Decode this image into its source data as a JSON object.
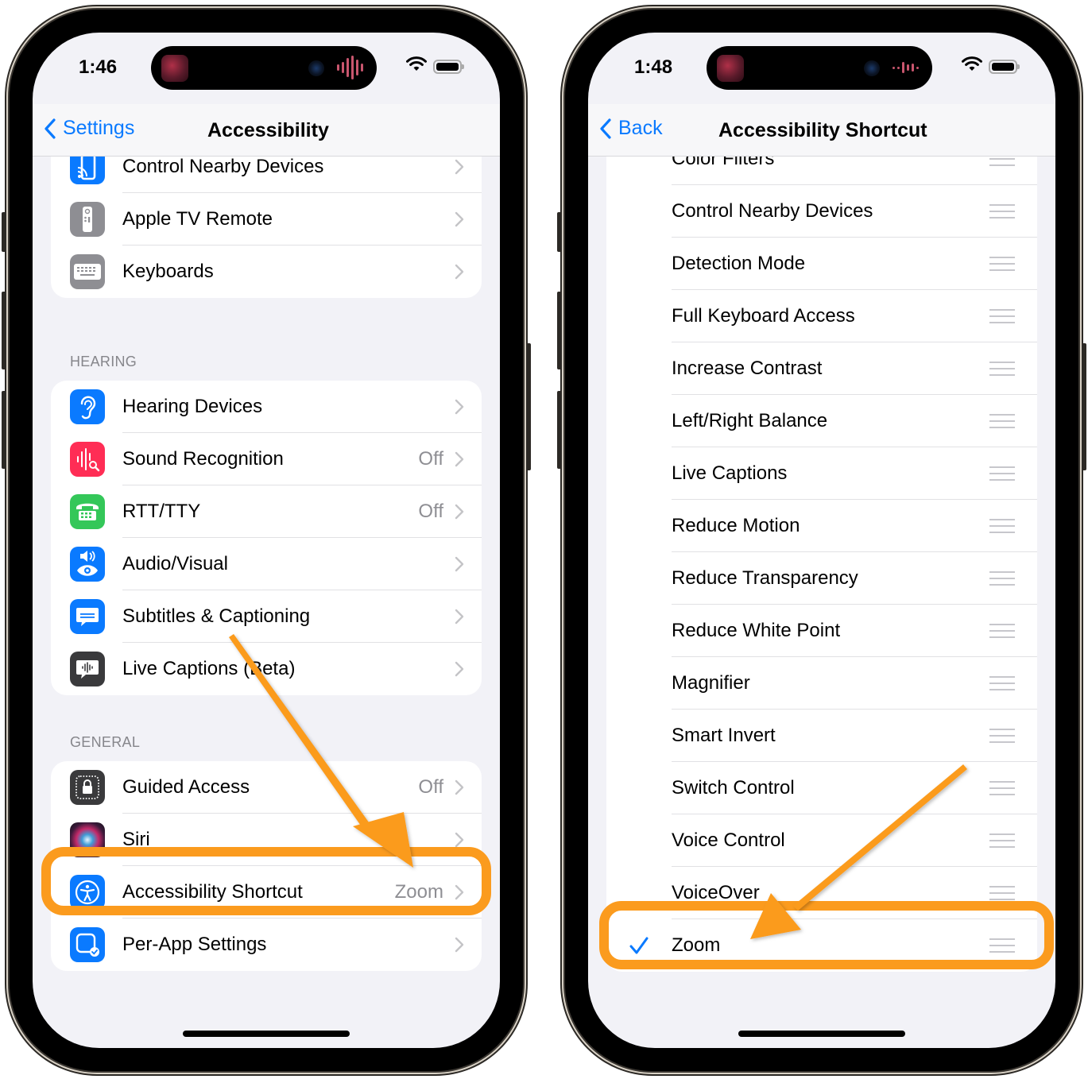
{
  "colors": {
    "accent": "#0a7aff",
    "annotation": "#fb9b1e",
    "secondary_text": "#8e8e93"
  },
  "left_phone": {
    "status": {
      "time": "1:46"
    },
    "nav": {
      "back_label": "Settings",
      "title": "Accessibility"
    },
    "group_top": [
      {
        "label": "Control Nearby Devices",
        "value": "",
        "icon": "control-nearby-devices-icon"
      },
      {
        "label": "Apple TV Remote",
        "value": "",
        "icon": "apple-tv-remote-icon"
      },
      {
        "label": "Keyboards",
        "value": "",
        "icon": "keyboard-icon"
      }
    ],
    "hearing": {
      "header": "HEARING",
      "items": [
        {
          "label": "Hearing Devices",
          "value": "",
          "icon": "ear-icon"
        },
        {
          "label": "Sound Recognition",
          "value": "Off",
          "icon": "sound-recognition-icon"
        },
        {
          "label": "RTT/TTY",
          "value": "Off",
          "icon": "tty-phone-icon"
        },
        {
          "label": "Audio/Visual",
          "value": "",
          "icon": "audio-visual-icon"
        },
        {
          "label": "Subtitles & Captioning",
          "value": "",
          "icon": "subtitles-icon"
        },
        {
          "label": "Live Captions (Beta)",
          "value": "",
          "icon": "live-captions-icon"
        }
      ]
    },
    "general": {
      "header": "GENERAL",
      "items": [
        {
          "label": "Guided Access",
          "value": "Off",
          "icon": "guided-access-lock-icon"
        },
        {
          "label": "Siri",
          "value": "",
          "icon": "siri-icon"
        },
        {
          "label": "Accessibility Shortcut",
          "value": "Zoom",
          "icon": "accessibility-person-icon"
        },
        {
          "label": "Per-App Settings",
          "value": "",
          "icon": "per-app-settings-icon"
        }
      ]
    }
  },
  "right_phone": {
    "status": {
      "time": "1:48"
    },
    "nav": {
      "back_label": "Back",
      "title": "Accessibility Shortcut"
    },
    "items": [
      {
        "label": "Color Filters",
        "checked": false
      },
      {
        "label": "Control Nearby Devices",
        "checked": false
      },
      {
        "label": "Detection Mode",
        "checked": false
      },
      {
        "label": "Full Keyboard Access",
        "checked": false
      },
      {
        "label": "Increase Contrast",
        "checked": false
      },
      {
        "label": "Left/Right Balance",
        "checked": false
      },
      {
        "label": "Live Captions",
        "checked": false
      },
      {
        "label": "Reduce Motion",
        "checked": false
      },
      {
        "label": "Reduce Transparency",
        "checked": false
      },
      {
        "label": "Reduce White Point",
        "checked": false
      },
      {
        "label": "Magnifier",
        "checked": false
      },
      {
        "label": "Smart Invert",
        "checked": false
      },
      {
        "label": "Switch Control",
        "checked": false
      },
      {
        "label": "Voice Control",
        "checked": false
      },
      {
        "label": "VoiceOver",
        "checked": false
      },
      {
        "label": "Zoom",
        "checked": true
      }
    ]
  }
}
